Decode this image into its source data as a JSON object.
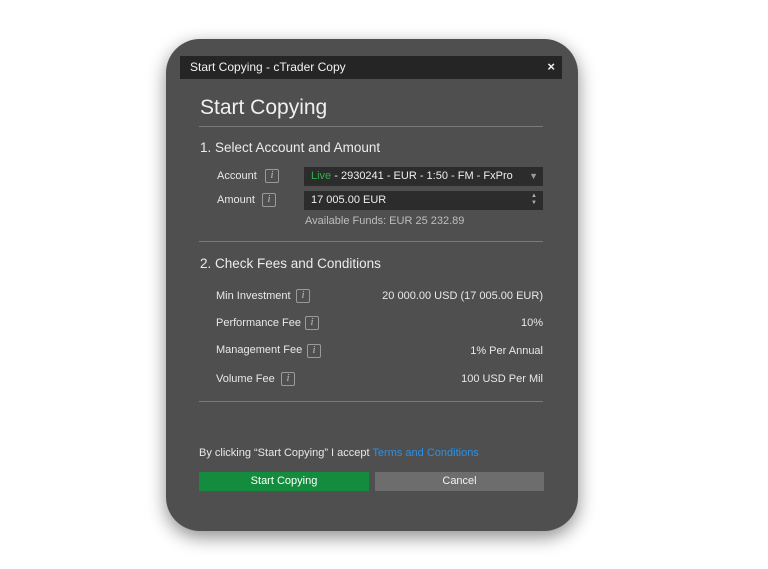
{
  "window": {
    "title": "Start Copying - cTrader Copy",
    "close_glyph": "×",
    "heading": "Start Copying"
  },
  "section1": {
    "title": "1. Select Account and Amount",
    "account_label": "Account",
    "account_value": {
      "type": "Live",
      "details": " - 2930241 - EUR - 1:50 - FM - FxPro"
    },
    "amount_label": "Amount",
    "amount_value": "17 005.00 EUR",
    "available_funds": "Available Funds:  EUR 25 232.89"
  },
  "section2": {
    "title": "2. Check Fees and Conditions",
    "rows": [
      {
        "label": "Min Investment",
        "value": "20 000.00 USD (17 005.00 EUR)"
      },
      {
        "label": "Performance Fee",
        "value": "10%"
      },
      {
        "label": "Management Fee",
        "value": "1% Per Annual"
      },
      {
        "label": "Volume Fee",
        "value": "100 USD Per Mil"
      }
    ]
  },
  "footer": {
    "consent_text": "By clicking “Start Copying” I accept ",
    "terms_link": "Terms and Conditions",
    "start_button": "Start Copying",
    "cancel_button": "Cancel"
  },
  "icons": {
    "info": "i",
    "dropdown": "▼",
    "up": "▲",
    "down": "▼"
  },
  "colors": {
    "panel": "#4f4f4f",
    "titlebar": "#252525",
    "live": "#2fb24a",
    "link": "#2f8fe0",
    "start_button": "#138c3e",
    "cancel_button": "#6d6d6d"
  }
}
